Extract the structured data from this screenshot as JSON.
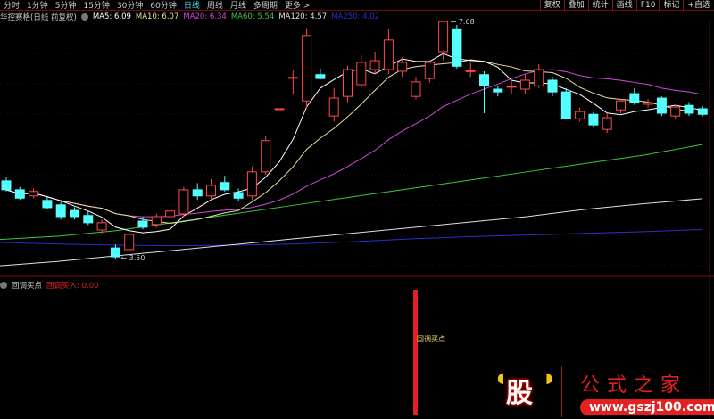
{
  "toolbar": {
    "periods": [
      "分时",
      "1分钟",
      "5分钟",
      "15分钟",
      "30分钟",
      "60分钟",
      "日线",
      "周线",
      "月线",
      "多周期",
      "更多 >"
    ],
    "active": "日线",
    "right_buttons": [
      "复权",
      "叠加",
      "统计",
      "画线",
      "F10",
      "标记",
      "+自选"
    ]
  },
  "legend": {
    "title": "华控赛格(日线 前复权)",
    "ma5": "MA5: 6.09",
    "ma10": "MA10: 6.07",
    "ma20": "MA20: 6.34",
    "ma60": "MA60: 5.54",
    "ma120": "MA120: 4.57",
    "ma250": "MA250: 4.02"
  },
  "colors": {
    "up": "#ff4a4a",
    "down": "#54ffff",
    "ma5": "#ffffff",
    "ma10": "#e8e0a0",
    "ma20": "#d04ad8",
    "ma60": "#3cc83c",
    "ma120": "#e0e0e0",
    "ma250": "#2830c8",
    "indicator": "#e52020"
  },
  "annotations": {
    "high": "7.68",
    "low": "3.50"
  },
  "indicator": {
    "name": "回调买点",
    "value_label": "回调买入: 0.00",
    "bar_label": "回调买点",
    "signal_index": 30
  },
  "logo": {
    "char": "股",
    "name": "公式之家",
    "url": "www.gszj100.com"
  },
  "chart_data": {
    "type": "candlestick",
    "price_range": [
      3.5,
      7.68
    ],
    "candles": [
      [
        4.89,
        4.95,
        4.7,
        4.73
      ],
      [
        4.73,
        4.78,
        4.55,
        4.58
      ],
      [
        4.62,
        4.75,
        4.58,
        4.7
      ],
      [
        4.54,
        4.6,
        4.38,
        4.41
      ],
      [
        4.46,
        4.52,
        4.2,
        4.25
      ],
      [
        4.36,
        4.42,
        4.2,
        4.25
      ],
      [
        4.27,
        4.35,
        4.1,
        4.14
      ],
      [
        4.01,
        4.2,
        3.95,
        4.14
      ],
      [
        3.69,
        3.75,
        3.5,
        3.53
      ],
      [
        3.66,
        3.98,
        3.62,
        3.93
      ],
      [
        4.17,
        4.25,
        4.02,
        4.06
      ],
      [
        4.11,
        4.3,
        4.05,
        4.25
      ],
      [
        4.25,
        4.42,
        4.2,
        4.35
      ],
      [
        4.3,
        4.78,
        4.25,
        4.73
      ],
      [
        4.73,
        4.85,
        4.55,
        4.62
      ],
      [
        4.62,
        4.92,
        4.55,
        4.81
      ],
      [
        4.86,
        4.98,
        4.7,
        4.73
      ],
      [
        4.68,
        4.75,
        4.52,
        4.58
      ],
      [
        4.62,
        5.15,
        4.55,
        5.05
      ],
      [
        5.05,
        5.7,
        5.0,
        5.61
      ],
      [
        6.18,
        6.18,
        6.18,
        6.18
      ],
      [
        6.74,
        6.88,
        6.45,
        6.74
      ],
      [
        6.32,
        7.62,
        6.18,
        7.49
      ],
      [
        6.79,
        6.9,
        6.7,
        6.72
      ],
      [
        6.05,
        6.55,
        5.95,
        6.37
      ],
      [
        6.4,
        6.95,
        6.3,
        6.88
      ],
      [
        6.61,
        7.15,
        6.55,
        7.01
      ],
      [
        6.88,
        7.2,
        6.8,
        7.04
      ],
      [
        6.88,
        7.6,
        6.8,
        7.41
      ],
      [
        6.85,
        7.1,
        6.75,
        7.01
      ],
      [
        6.4,
        6.75,
        6.35,
        6.66
      ],
      [
        6.72,
        7.05,
        6.65,
        7.01
      ],
      [
        7.2,
        7.68,
        7.05,
        7.74
      ],
      [
        7.61,
        7.68,
        6.9,
        6.94
      ],
      [
        6.85,
        7.0,
        6.75,
        6.86
      ],
      [
        6.79,
        6.85,
        6.1,
        6.59
      ],
      [
        6.53,
        6.58,
        6.4,
        6.48
      ],
      [
        6.58,
        6.7,
        6.45,
        6.58
      ],
      [
        6.53,
        6.8,
        6.45,
        6.69
      ],
      [
        6.59,
        6.98,
        6.55,
        6.88
      ],
      [
        6.69,
        6.75,
        6.4,
        6.48
      ],
      [
        6.48,
        6.55,
        6.0,
        6.0
      ],
      [
        6.0,
        6.2,
        5.95,
        6.13
      ],
      [
        6.08,
        6.12,
        5.85,
        5.89
      ],
      [
        5.81,
        6.1,
        5.75,
        6.02
      ],
      [
        6.16,
        6.35,
        6.1,
        6.32
      ],
      [
        6.45,
        6.55,
        6.25,
        6.29
      ],
      [
        6.26,
        6.35,
        6.2,
        6.29
      ],
      [
        6.37,
        6.4,
        6.05,
        6.1
      ],
      [
        6.05,
        6.25,
        6.0,
        6.21
      ],
      [
        6.24,
        6.3,
        6.05,
        6.1
      ],
      [
        6.18,
        6.22,
        6.05,
        6.08
      ]
    ],
    "ma60": [
      3.84,
      3.9,
      4.0,
      4.15,
      4.3,
      4.45,
      4.6,
      4.75,
      4.9,
      5.05,
      5.2,
      5.35,
      5.54
    ],
    "ma120": [
      3.37,
      3.45,
      3.55,
      3.65,
      3.75,
      3.85,
      3.95,
      4.05,
      4.15,
      4.25,
      4.38,
      4.48,
      4.57
    ],
    "ma250": [
      3.79,
      3.76,
      3.74,
      3.73,
      3.74,
      3.76,
      3.8,
      3.85,
      3.89,
      3.92,
      3.95,
      3.98,
      4.02
    ]
  }
}
